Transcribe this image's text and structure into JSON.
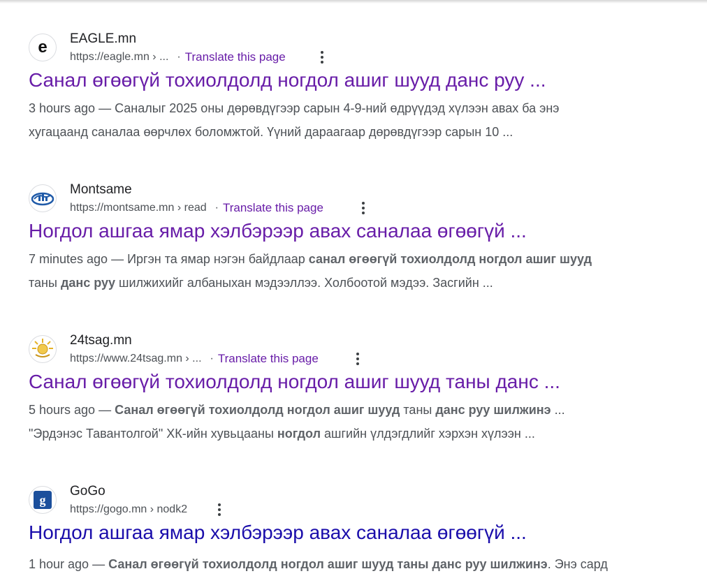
{
  "results": [
    {
      "site_name": "EAGLE.mn",
      "favicon_icon": "eagle-e-icon",
      "url": "https://eagle.mn › ...",
      "translate_label": "Translate this page",
      "title": "Санал өгөөгүй тохиолдолд ногдол ашиг шууд данс руу ...",
      "visited": true,
      "date": "3 hours ago",
      "dash": " — ",
      "line1": "Саналыг 2025 оны дөрөвдүгээр сарын 4-9-ний өдрүүдэд хүлээн авах ба энэ",
      "line2": "хугацаанд саналаа өөрчлөх боломжтой. Үүний дараагаар дөрөвдүгээр сарын 10 ..."
    },
    {
      "site_name": "Montsame",
      "favicon_icon": "montsame-globe-icon",
      "url": "https://montsame.mn › read",
      "translate_label": "Translate this page",
      "title": "Ногдол ашгаа ямар хэлбэрээр авах саналаа өгөөгүй ...",
      "visited": true,
      "date": "7 minutes ago",
      "dash": " — ",
      "line1_a": "Иргэн та ямар нэгэн байдлаар ",
      "line1_b": "санал өгөөгүй тохиолдолд ногдол ашиг шууд",
      "line2_a": "таны ",
      "line2_b": "данс руу",
      "line2_c": " шилжихийг албаныхан мэдээллээ. Холбоотой мэдээ. Засгийн ..."
    },
    {
      "site_name": "24tsag.mn",
      "favicon_icon": "24tsag-sun-icon",
      "url": "https://www.24tsag.mn › ...",
      "translate_label": "Translate this page",
      "title": "Санал өгөөгүй тохиолдолд ногдол ашиг шууд таны данс ...",
      "visited": true,
      "date": "5 hours ago",
      "dash": " — ",
      "line1_a": "Санал өгөөгүй тохиолдолд ногдол ашиг шууд",
      "line1_b": " таны ",
      "line1_c": "данс руу шилжинэ",
      "line1_d": " ...",
      "line2_a": "\"Эрдэнэс Тавантолгой\" ХК-ийн хувьцааны ",
      "line2_b": "ногдол",
      "line2_c": " ашгийн үлдэгдлийг хэрхэн хүлээн ..."
    },
    {
      "site_name": "GoGo",
      "favicon_icon": "gogo-g-icon",
      "url": "https://gogo.mn › nodk2",
      "title": "Ногдол ашгаа ямар хэлбэрээр авах саналаа өгөөгүй ...",
      "visited": false,
      "date": "1 hour ago",
      "dash": " — ",
      "line1_a": "Санал өгөөгүй тохиолдолд ногдол ашиг шууд таны данс руу шилжинэ",
      "line1_b": ". Энэ сард"
    }
  ],
  "colors": {
    "visited_link": "#681da8",
    "unvisited_link": "#1a0dab",
    "snippet": "#4d5156"
  }
}
